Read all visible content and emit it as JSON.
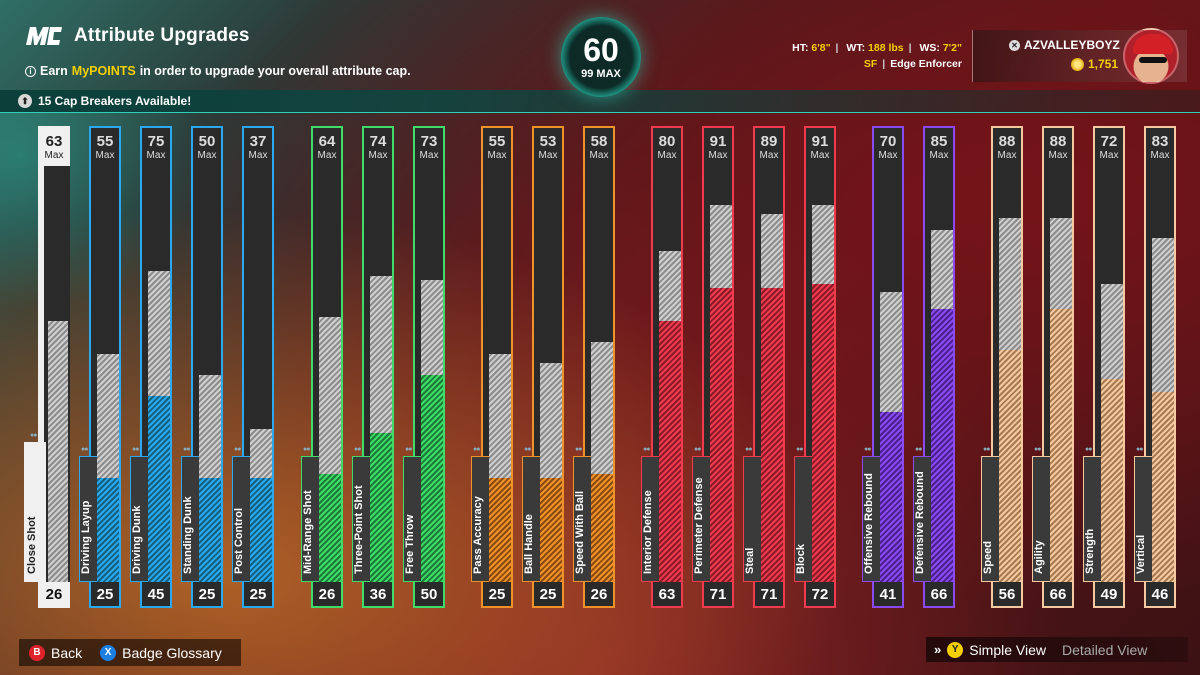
{
  "header": {
    "logo_text": "MC",
    "title": "Attribute Upgrades",
    "subtitle_pre": "Earn ",
    "subtitle_highlight": "MyPOINTS",
    "subtitle_post": " in order to upgrade your overall attribute cap.",
    "cap_breakers": "15 Cap Breakers Available!"
  },
  "overall": {
    "value": "60",
    "max": "99 MAX"
  },
  "player": {
    "ht_label": "HT:",
    "ht": "6'8\"",
    "wt_label": "WT:",
    "wt": "188 lbs",
    "ws_label": "WS:",
    "ws": "7'2\"",
    "position": "SF",
    "archetype": "Edge Enforcer",
    "gamertag": "AZVALLEYBOYZ",
    "vc": "1,751"
  },
  "max_label": "Max",
  "attributes": [
    {
      "name": "Close Shot",
      "max": "63",
      "current": "26",
      "color": "#f0f0f0",
      "dark": "#9a9a9a",
      "selected": true,
      "cur_frac": 0.26,
      "max_frac": 0.63
    },
    {
      "name": "Driving Layup",
      "max": "55",
      "current": "25",
      "color": "#2aa8f0",
      "dark": "#13607f",
      "cur_frac": 0.25,
      "max_frac": 0.55
    },
    {
      "name": "Driving Dunk",
      "max": "75",
      "current": "45",
      "color": "#2aa8f0",
      "dark": "#13607f",
      "cur_frac": 0.45,
      "max_frac": 0.75
    },
    {
      "name": "Standing Dunk",
      "max": "50",
      "current": "25",
      "color": "#2aa8f0",
      "dark": "#13607f",
      "cur_frac": 0.25,
      "max_frac": 0.5
    },
    {
      "name": "Post Control",
      "max": "37",
      "current": "25",
      "color": "#2aa8f0",
      "dark": "#13607f",
      "cur_frac": 0.25,
      "max_frac": 0.37
    },
    {
      "name": "Mid-Range Shot",
      "max": "64",
      "current": "26",
      "color": "#3fdc6a",
      "dark": "#1b7a36",
      "cur_frac": 0.26,
      "max_frac": 0.64
    },
    {
      "name": "Three-Point Shot",
      "max": "74",
      "current": "36",
      "color": "#3fdc6a",
      "dark": "#1b7a36",
      "cur_frac": 0.36,
      "max_frac": 0.74
    },
    {
      "name": "Free Throw",
      "max": "73",
      "current": "50",
      "color": "#3fdc6a",
      "dark": "#1b7a36",
      "cur_frac": 0.5,
      "max_frac": 0.73
    },
    {
      "name": "Pass Accuracy",
      "max": "55",
      "current": "25",
      "color": "#f0922a",
      "dark": "#8a4a10",
      "cur_frac": 0.25,
      "max_frac": 0.55
    },
    {
      "name": "Ball Handle",
      "max": "53",
      "current": "25",
      "color": "#f0922a",
      "dark": "#8a4a10",
      "cur_frac": 0.25,
      "max_frac": 0.53
    },
    {
      "name": "Speed With Ball",
      "max": "58",
      "current": "26",
      "color": "#f0922a",
      "dark": "#8a4a10",
      "cur_frac": 0.26,
      "max_frac": 0.58
    },
    {
      "name": "Interior Defense",
      "max": "80",
      "current": "63",
      "color": "#f03a4e",
      "dark": "#8a1a28",
      "cur_frac": 0.63,
      "max_frac": 0.8
    },
    {
      "name": "Perimeter Defense",
      "max": "91",
      "current": "71",
      "color": "#f03a4e",
      "dark": "#8a1a28",
      "cur_frac": 0.71,
      "max_frac": 0.91
    },
    {
      "name": "Steal",
      "max": "89",
      "current": "71",
      "color": "#f03a4e",
      "dark": "#8a1a28",
      "cur_frac": 0.71,
      "max_frac": 0.89
    },
    {
      "name": "Block",
      "max": "91",
      "current": "72",
      "color": "#f03a4e",
      "dark": "#8a1a28",
      "cur_frac": 0.72,
      "max_frac": 0.91
    },
    {
      "name": "Offensive Rebound",
      "max": "70",
      "current": "41",
      "color": "#8a4af0",
      "dark": "#4a2090",
      "cur_frac": 0.41,
      "max_frac": 0.7
    },
    {
      "name": "Defensive Rebound",
      "max": "85",
      "current": "66",
      "color": "#8a4af0",
      "dark": "#4a2090",
      "cur_frac": 0.66,
      "max_frac": 0.85
    },
    {
      "name": "Speed",
      "max": "88",
      "current": "56",
      "color": "#f4c9a0",
      "dark": "#a87a50",
      "cur_frac": 0.56,
      "max_frac": 0.88
    },
    {
      "name": "Agility",
      "max": "88",
      "current": "66",
      "color": "#f4c9a0",
      "dark": "#a87a50",
      "cur_frac": 0.66,
      "max_frac": 0.88
    },
    {
      "name": "Strength",
      "max": "72",
      "current": "49",
      "color": "#f4c9a0",
      "dark": "#a87a50",
      "cur_frac": 0.49,
      "max_frac": 0.72
    },
    {
      "name": "Vertical",
      "max": "83",
      "current": "46",
      "color": "#f4c9a0",
      "dark": "#a87a50",
      "cur_frac": 0.46,
      "max_frac": 0.83
    }
  ],
  "footer": {
    "back_btn": "B",
    "back": "Back",
    "glossary_btn": "X",
    "glossary": "Badge Glossary",
    "view_btn": "Y",
    "simple_view": "Simple View",
    "detailed_view": "Detailed View"
  }
}
